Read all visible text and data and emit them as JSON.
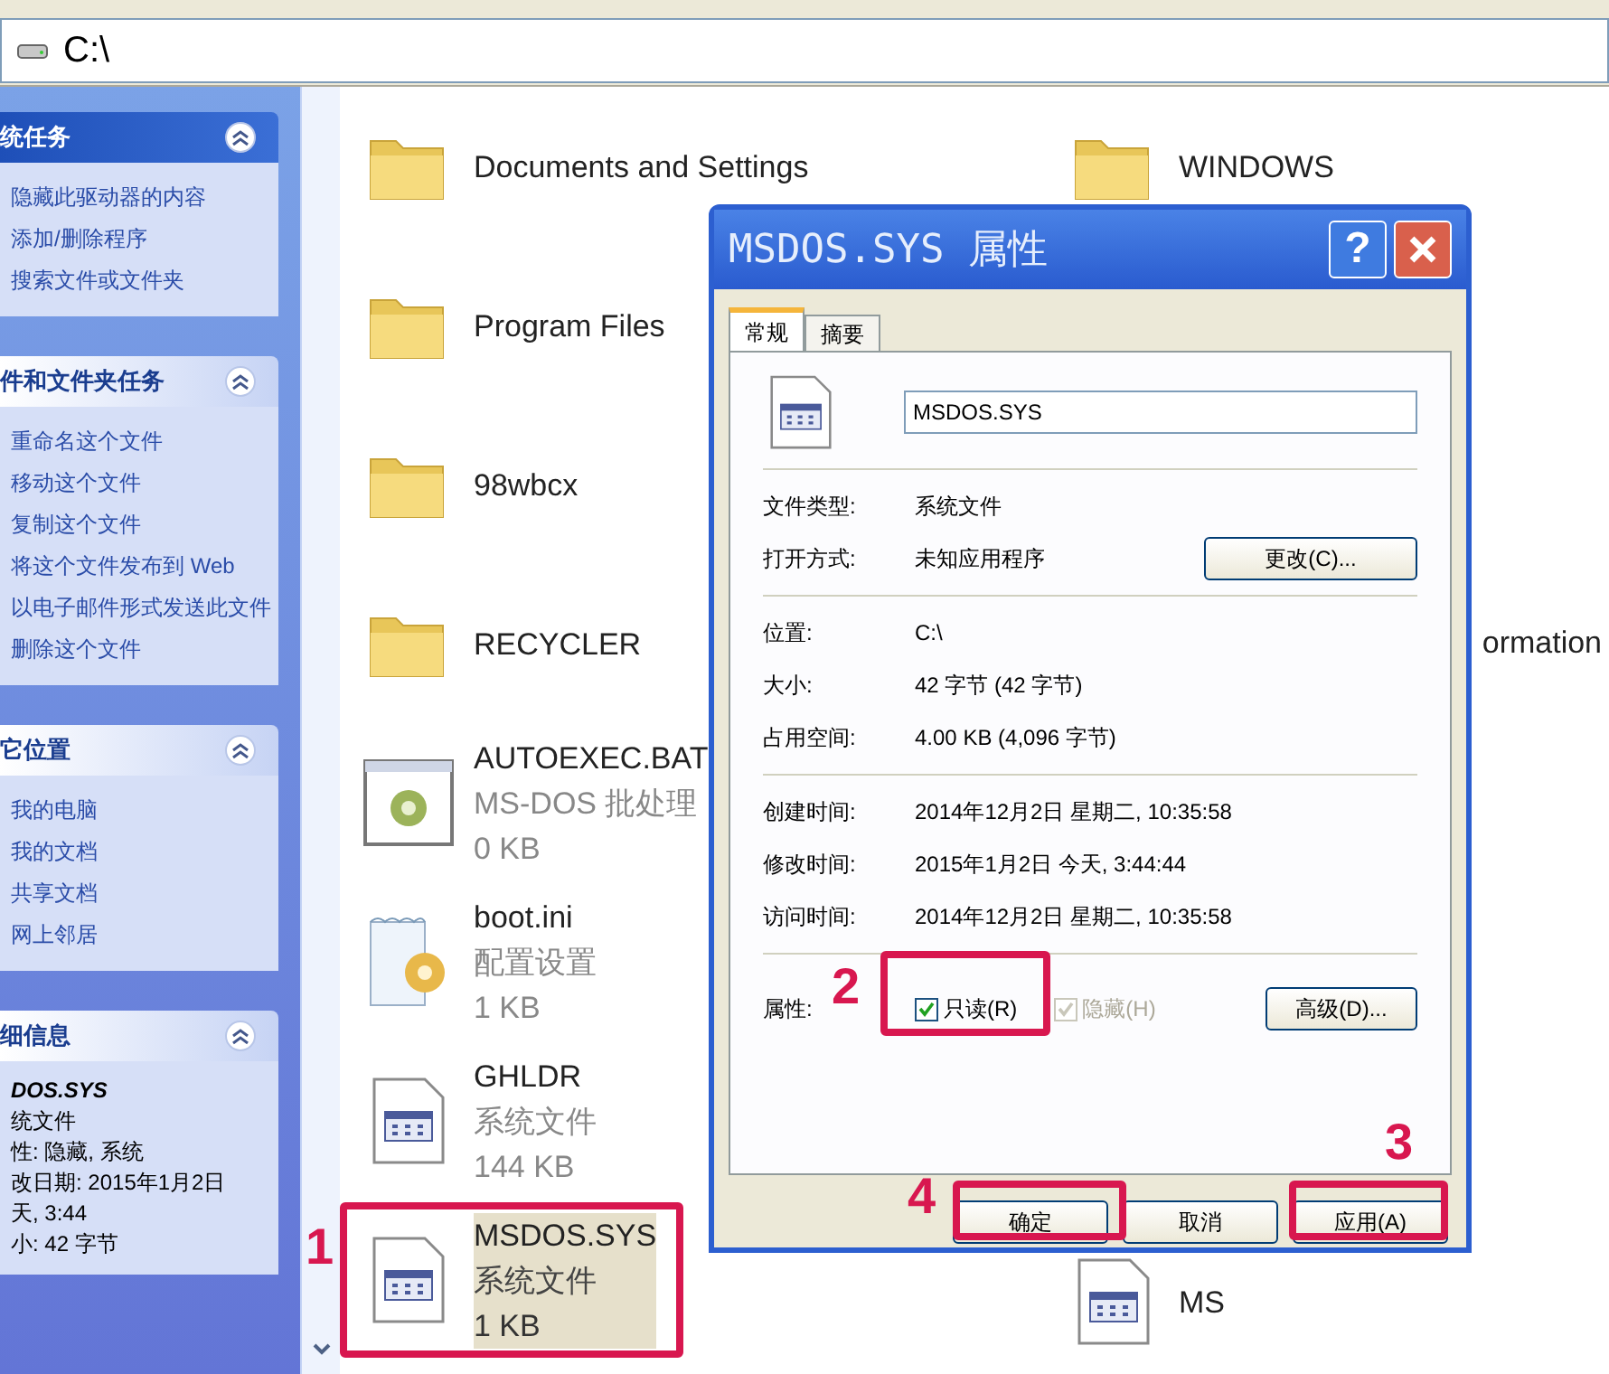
{
  "address_bar": {
    "path": "C:\\"
  },
  "sidebar": {
    "panels": [
      {
        "kind": "primary",
        "title": "统任务",
        "items": [
          "隐藏此驱动器的内容",
          "添加/删除程序",
          "搜索文件或文件夹"
        ]
      },
      {
        "kind": "normal",
        "title": "件和文件夹任务",
        "items": [
          "重命名这个文件",
          "移动这个文件",
          "复制这个文件",
          "将这个文件发布到 Web",
          "以电子邮件形式发送此文件",
          "删除这个文件"
        ]
      },
      {
        "kind": "normal",
        "title": "它位置",
        "items": [
          "我的电脑",
          "我的文档",
          "共享文档",
          "网上邻居"
        ]
      },
      {
        "kind": "details",
        "title": "细信息",
        "name": "DOS.SYS",
        "lines": [
          "统文件",
          "性: 隐藏, 系统",
          "改日期: 2015年1月2日",
          "天, 3:44",
          "小: 42 字节"
        ]
      }
    ]
  },
  "files": {
    "rows": [
      {
        "left": {
          "kind": "folder",
          "name": "Documents and Settings",
          "selected": false
        },
        "right": {
          "kind": "folder",
          "name": "WINDOWS",
          "selected": false
        }
      },
      {
        "left": {
          "kind": "folder",
          "name": "Program Files",
          "selected": false
        }
      },
      {
        "left": {
          "kind": "folder",
          "name": "98wbcx",
          "selected": false
        }
      },
      {
        "left": {
          "kind": "folder",
          "name": "RECYCLER",
          "selected": false
        },
        "right": {
          "kind": "cut_label",
          "name": "ormation",
          "selected": false
        }
      },
      {
        "left": {
          "kind": "batch",
          "name": "AUTOEXEC.BAT",
          "type": "MS-DOS 批处理",
          "size": "0 KB",
          "selected": false
        }
      },
      {
        "left": {
          "kind": "settings",
          "name": "boot.ini",
          "type": "配置设置",
          "size": "1 KB",
          "selected": false
        }
      },
      {
        "left": {
          "kind": "system",
          "name": "GHLDR",
          "type": "系统文件",
          "size": "144 KB",
          "selected": false
        }
      },
      {
        "left": {
          "kind": "system",
          "name": "MSDOS.SYS",
          "type": "系统文件",
          "size": "1 KB",
          "selected": true
        },
        "right": {
          "kind": "cut_system",
          "name": "MS",
          "selected": false
        }
      }
    ]
  },
  "dialog": {
    "title": "MSDOS.SYS 属性",
    "help": "?",
    "tabs": [
      {
        "label": "常规",
        "selected": true
      },
      {
        "label": "摘要",
        "selected": false
      }
    ],
    "file_name": "MSDOS.SYS",
    "groups": [
      [
        {
          "label": "文件类型:",
          "value": "系统文件"
        },
        {
          "label": "打开方式:",
          "value": "未知应用程序",
          "button": "更改(C)..."
        }
      ],
      [
        {
          "label": "位置:",
          "value": "C:\\"
        },
        {
          "label": "大小:",
          "value": "42 字节 (42 字节)"
        },
        {
          "label": "占用空间:",
          "value": "4.00 KB (4,096 字节)"
        }
      ],
      [
        {
          "label": "创建时间:",
          "value": "2014年12月2日 星期二, 10:35:58"
        },
        {
          "label": "修改时间:",
          "value": "2015年1月2日 今天, 3:44:44"
        },
        {
          "label": "访问时间:",
          "value": "2014年12月2日 星期二, 10:35:58"
        }
      ]
    ],
    "attributes": {
      "label": "属性:",
      "checkboxes": [
        {
          "label": "只读(R)",
          "checked": true,
          "disabled": false
        },
        {
          "label": "隐藏(H)",
          "checked": true,
          "disabled": true
        }
      ],
      "advanced": "高级(D)..."
    },
    "buttons": [
      "确定",
      "取消",
      "应用(A)"
    ]
  },
  "annotations": [
    {
      "number": "1"
    },
    {
      "number": "2"
    },
    {
      "number": "3"
    },
    {
      "number": "4"
    }
  ]
}
